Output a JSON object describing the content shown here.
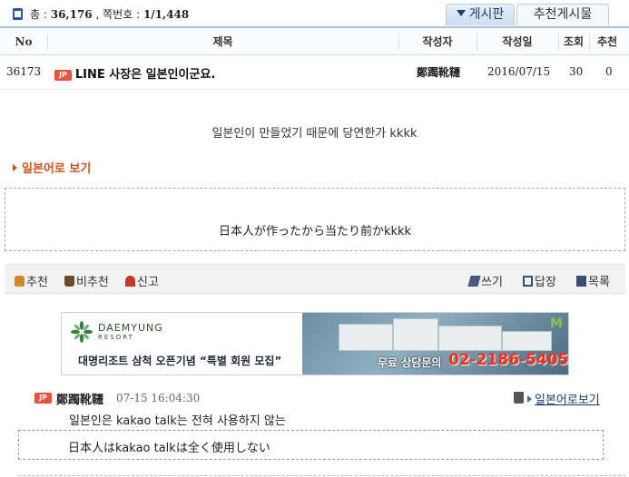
{
  "header": {
    "total_prefix": "총 :",
    "total_count": "36,176",
    "page_label": ", 쪽번호 :",
    "page_value": "1/1,448"
  },
  "tabs": [
    {
      "label": "게시판",
      "active": true
    },
    {
      "label": "추천게시물",
      "active": false
    }
  ],
  "table": {
    "columns": [
      "No",
      "제목",
      "작성자",
      "작성일",
      "조회",
      "추천"
    ],
    "row": {
      "no": "36173",
      "badge": "JP",
      "title": "LINE 사장은 일본인이군요.",
      "author": "鄭躅靴韆",
      "date": "2016/07/15",
      "views": "30",
      "recommends": "0"
    }
  },
  "post": {
    "body_ko": "일본인이 만들었기 때문에 당연한가 kkkk",
    "jp_toggle": "일본어로 보기",
    "body_jp": "日本人が作ったから当たり前かkkkk"
  },
  "actions": {
    "recommend": "추천",
    "not_recommend": "비추천",
    "report": "신고",
    "write": "쓰기",
    "reply": "답장",
    "list": "목록"
  },
  "ad": {
    "brand": "DAEMYUNG",
    "brand_sub": "RESORT",
    "headline": "대명리조트 삼척 오픈기념 “특별 회원 모집”",
    "phone_label": "무료 상담문의",
    "phone": "02-2186-5405",
    "corner_mark": "M"
  },
  "comment": {
    "badge": "JP",
    "author": "鄭躅靴韆",
    "time": "07-15 16:04:30",
    "jp_link": "일본어로보기",
    "text_ko": "일본인은 kakao talk는 전혀 사용하지 않는",
    "text_jp": "日本人はkakao talkは全く使用しない"
  },
  "colors": {
    "accent_blue": "#1d3f74",
    "jp_badge": "#e5533a",
    "jp_toggle": "#d4521a",
    "ad_phone": "#ff2e1a"
  }
}
